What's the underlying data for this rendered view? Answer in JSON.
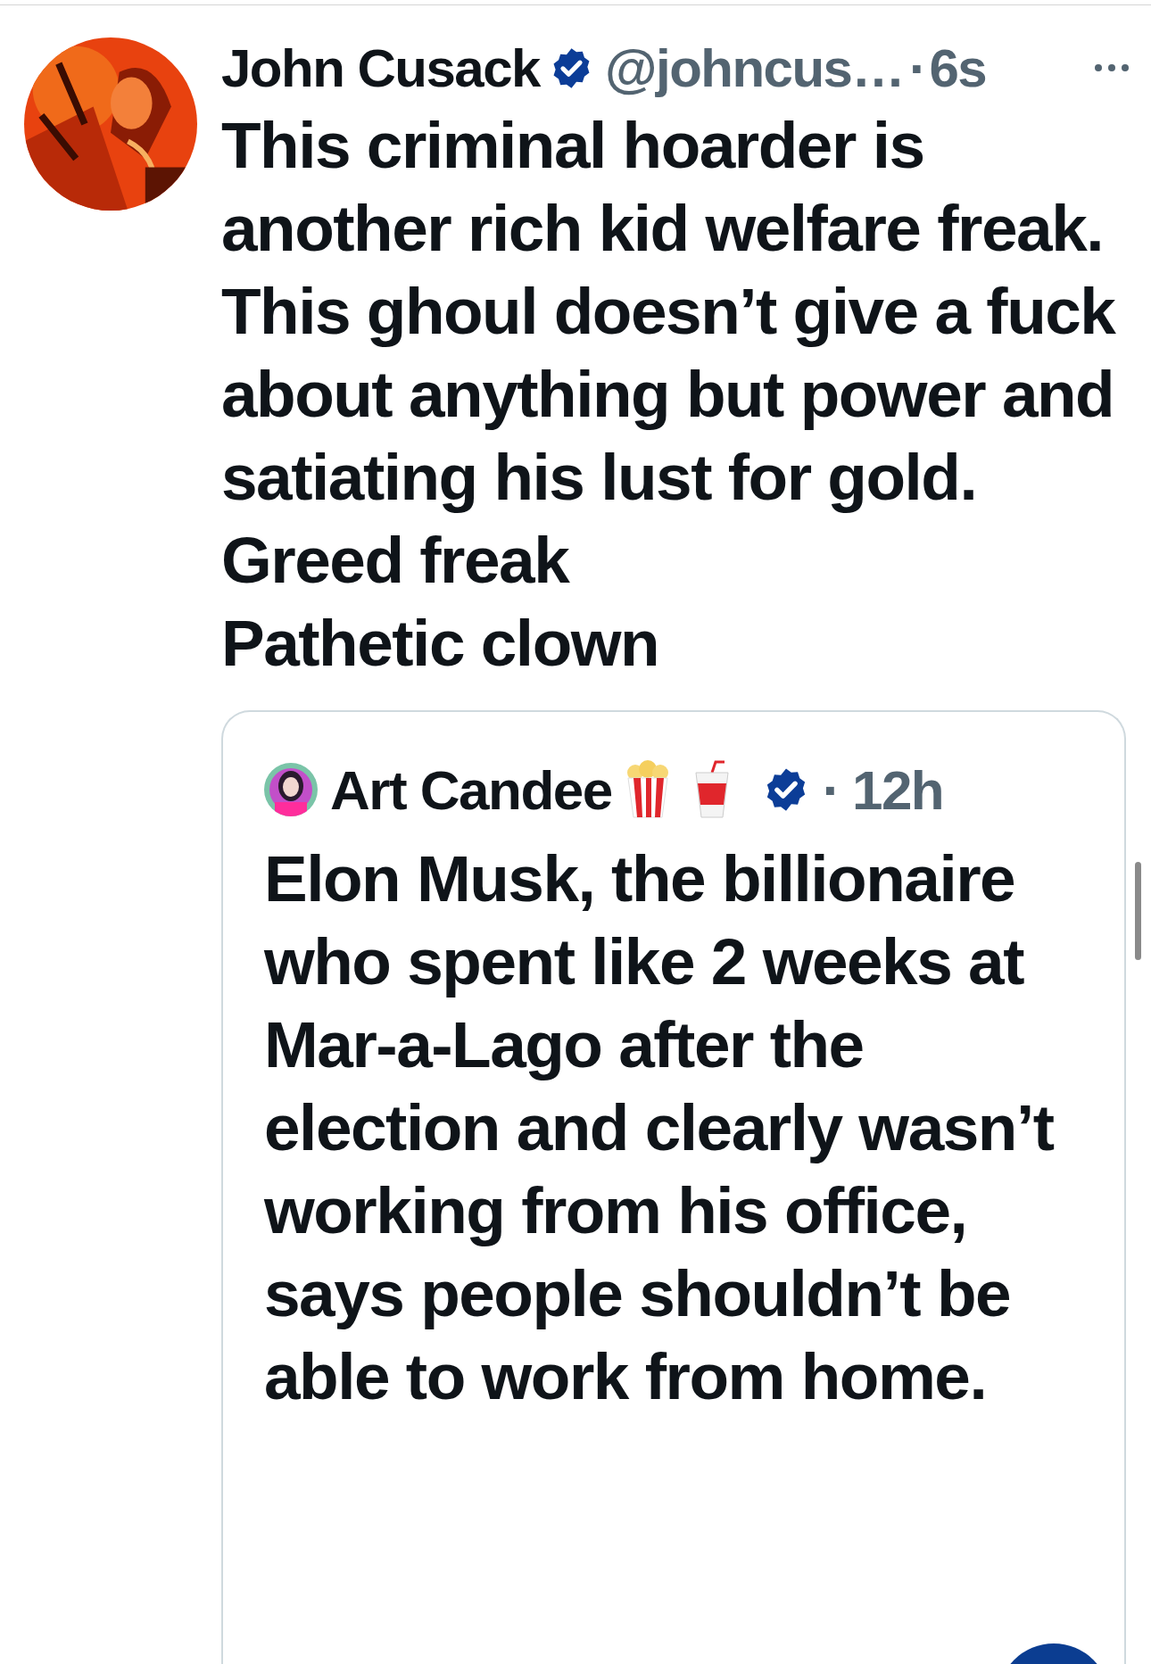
{
  "tweet": {
    "author": {
      "name": "John Cusack",
      "verified": true,
      "handle": "@johncus…",
      "separator": "·",
      "time": "6s"
    },
    "text": "This criminal hoarder is another rich kid welfare freak.\nThis ghoul doesn’t give a fuck about anything but power and satiating his lust for gold. Greed freak\nPathetic clown",
    "quote": {
      "author": {
        "name": "Art Candee",
        "verified": true,
        "separator": "·",
        "time": "12h"
      },
      "text": "Elon Musk, the billionaire who spent like 2 weeks at Mar-a-Lago after the election and clearly wasn’t working from his office, says people shouldn’t be able to work from home."
    }
  }
}
